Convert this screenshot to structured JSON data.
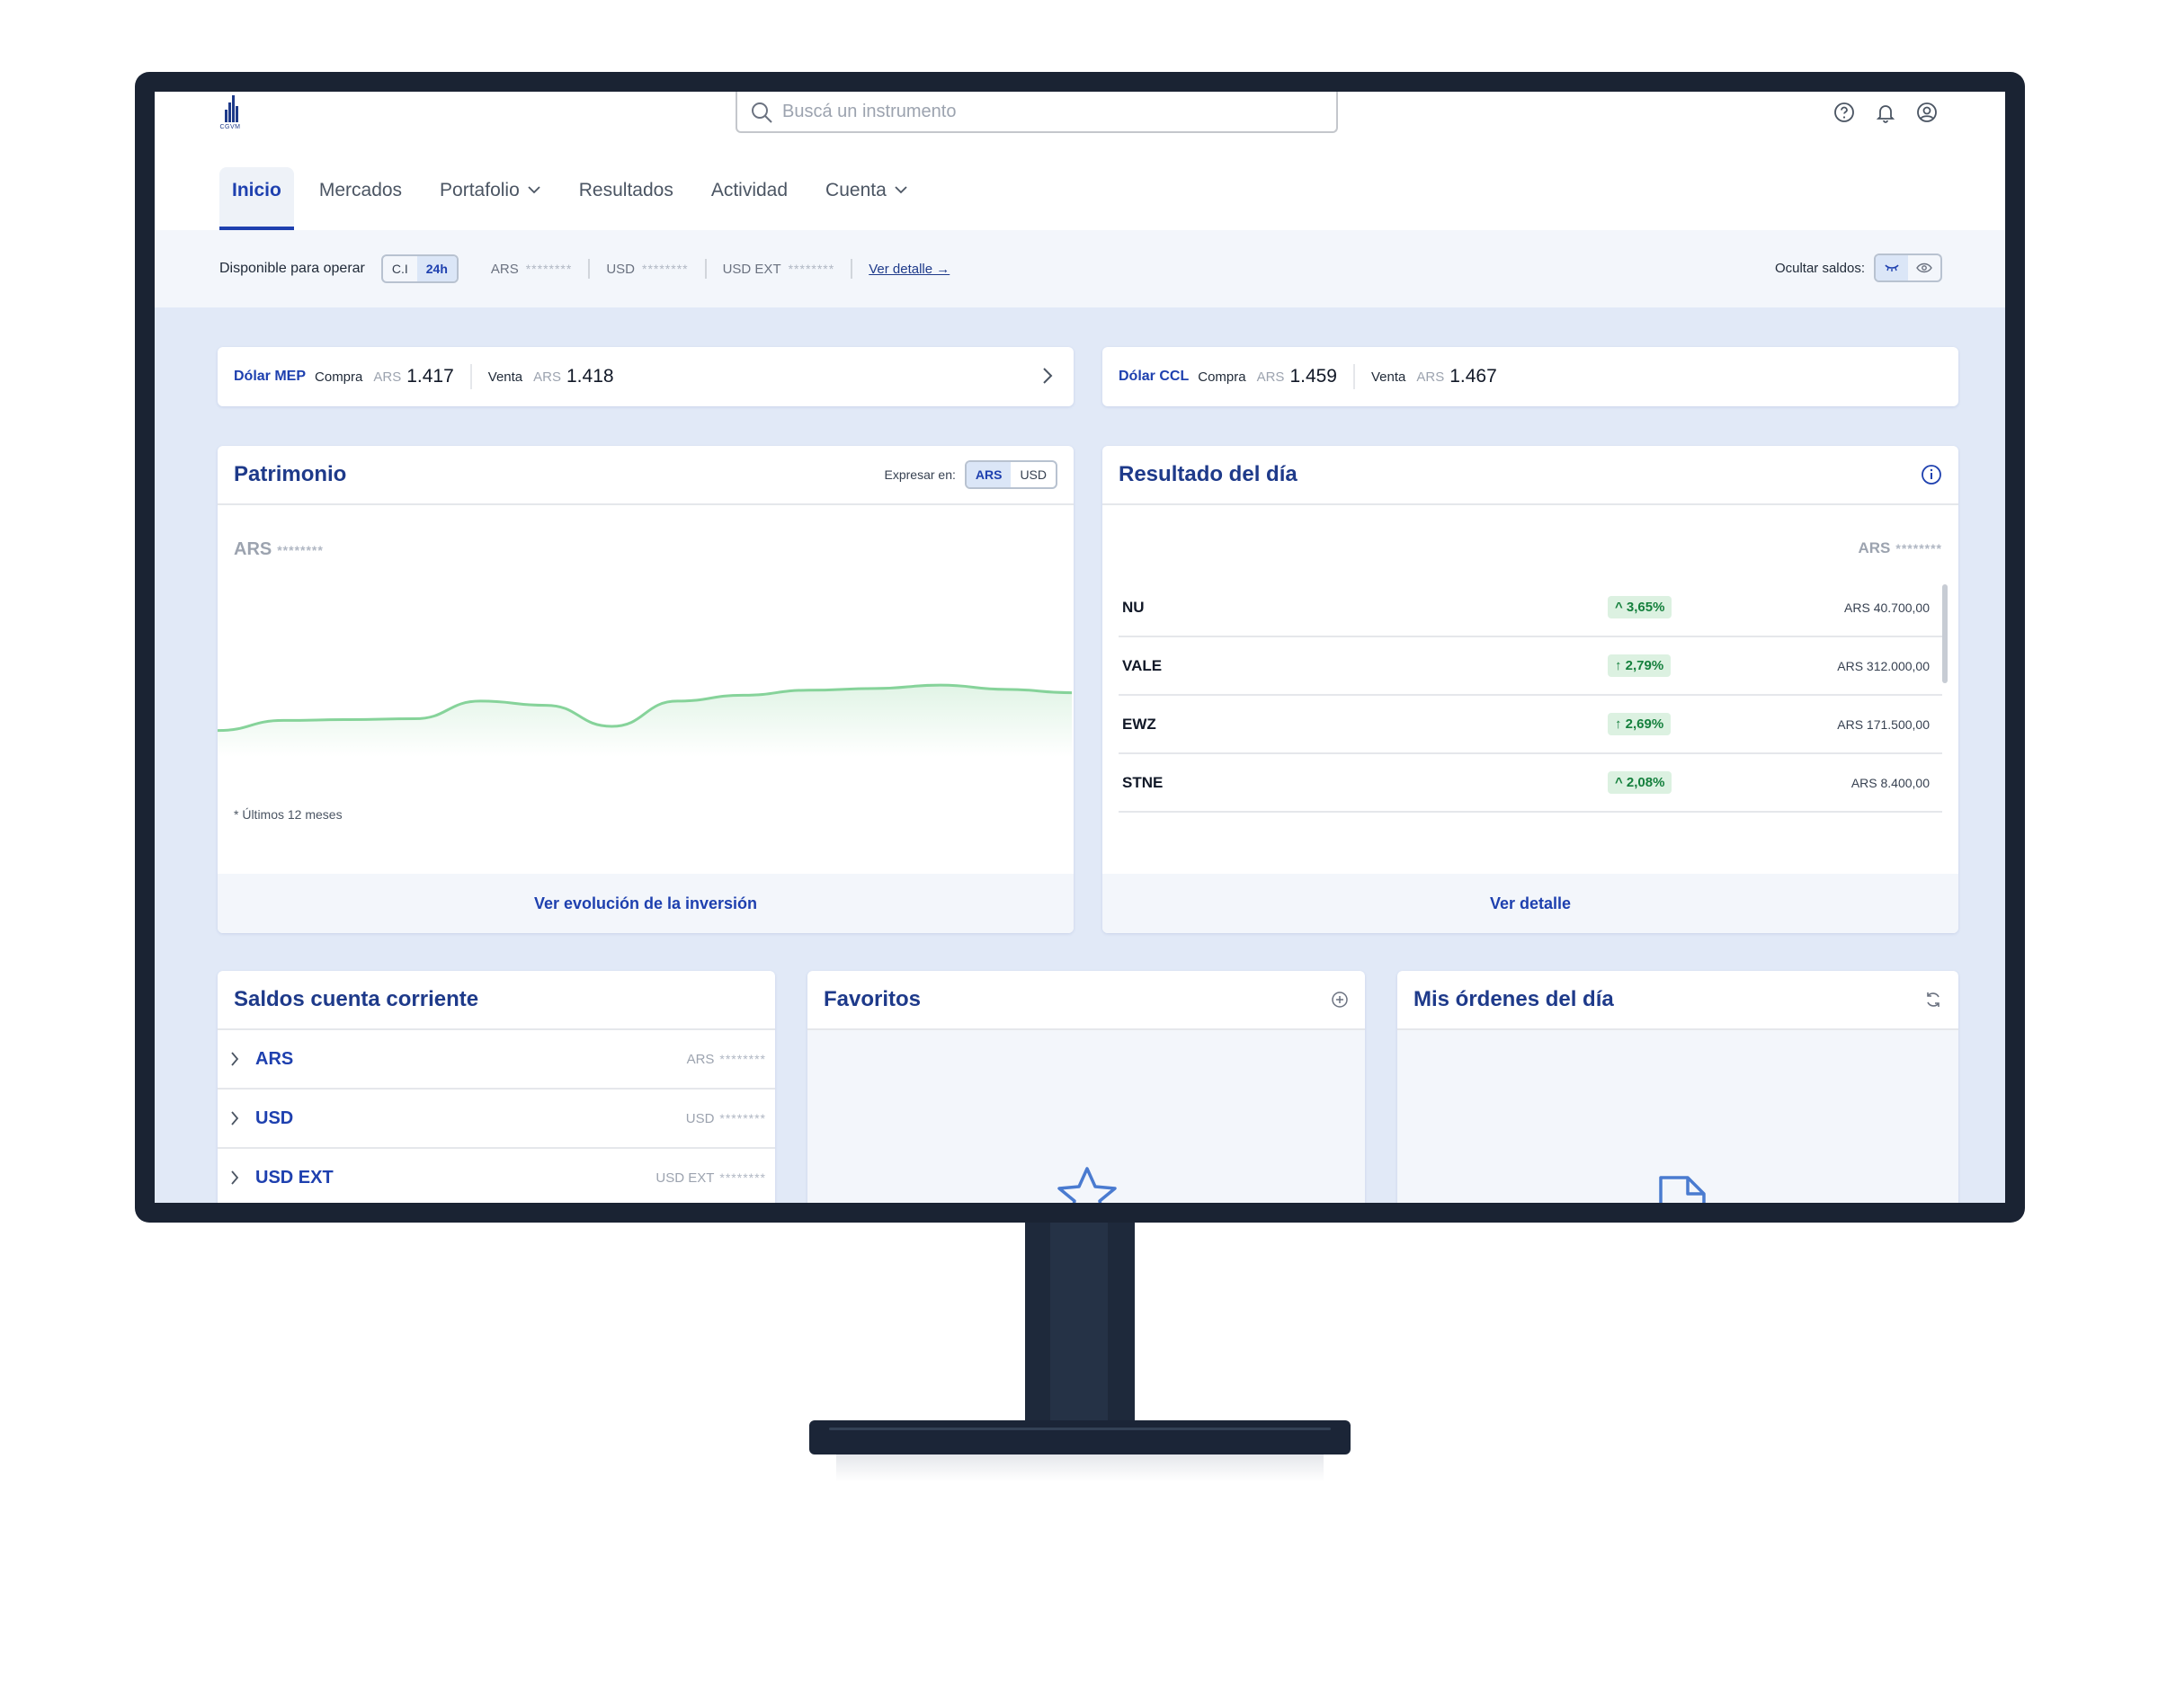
{
  "header": {
    "logo_text": "CGVM",
    "search_placeholder": "Buscá un instrumento",
    "icons": [
      "help-icon",
      "bell-icon",
      "user-icon"
    ]
  },
  "nav": {
    "tabs": [
      {
        "label": "Inicio",
        "active": true
      },
      {
        "label": "Mercados"
      },
      {
        "label": "Portafolio",
        "dropdown": true
      },
      {
        "label": "Resultados"
      },
      {
        "label": "Actividad"
      },
      {
        "label": "Cuenta",
        "dropdown": true
      }
    ]
  },
  "available": {
    "label": "Disponible para operar",
    "settlement_options": [
      "C.I",
      "24h"
    ],
    "settlement_selected": "24h",
    "balances": [
      {
        "currency": "ARS",
        "value": "********"
      },
      {
        "currency": "USD",
        "value": "********"
      },
      {
        "currency": "USD EXT",
        "value": "********"
      }
    ],
    "detail_link": "Ver detalle →",
    "hide_label": "Ocultar saldos:"
  },
  "fx": [
    {
      "name": "Dólar MEP",
      "buy_label": "Compra",
      "buy_currency": "ARS",
      "buy_value": "1.417",
      "sell_label": "Venta",
      "sell_currency": "ARS",
      "sell_value": "1.418"
    },
    {
      "name": "Dólar CCL",
      "buy_label": "Compra",
      "buy_currency": "ARS",
      "buy_value": "1.459",
      "sell_label": "Venta",
      "sell_currency": "ARS",
      "sell_value": "1.467"
    }
  ],
  "patrimonio": {
    "title": "Patrimonio",
    "express_label": "Expresar en:",
    "express_options": [
      "ARS",
      "USD"
    ],
    "express_selected": "ARS",
    "balance_currency": "ARS",
    "balance_value": "********",
    "note": "* Últimos 12 meses",
    "footer_link": "Ver evolución de la inversión",
    "sparkline_relative_values": [
      0.1,
      0.22,
      0.23,
      0.24,
      0.45,
      0.4,
      0.15,
      0.45,
      0.52,
      0.58,
      0.6,
      0.64,
      0.59,
      0.55
    ]
  },
  "resultado": {
    "title": "Resultado del día",
    "currency": "ARS",
    "value": "********",
    "rows": [
      {
        "symbol": "NU",
        "change": "^ 3,65%",
        "amount": "ARS 40.700,00"
      },
      {
        "symbol": "VALE",
        "change": "↑ 2,79%",
        "amount": "ARS 312.000,00"
      },
      {
        "symbol": "EWZ",
        "change": "↑ 2,69%",
        "amount": "ARS 171.500,00"
      },
      {
        "symbol": "STNE",
        "change": "^ 2,08%",
        "amount": "ARS 8.400,00"
      }
    ],
    "footer_link": "Ver detalle"
  },
  "saldos": {
    "title": "Saldos cuenta corriente",
    "rows": [
      {
        "name": "ARS",
        "currency": "ARS",
        "value": "********"
      },
      {
        "name": "USD",
        "currency": "USD",
        "value": "********"
      },
      {
        "name": "USD EXT",
        "currency": "USD EXT",
        "value": "********"
      }
    ]
  },
  "favoritos": {
    "title": "Favoritos"
  },
  "ordenes": {
    "title": "Mis órdenes del día"
  },
  "colors": {
    "brand": "#1e40af",
    "accent_bg": "#e1e9f7",
    "positive": "#15803d",
    "positive_bg": "#dcf1e1",
    "chart_line": "#86d39a"
  }
}
